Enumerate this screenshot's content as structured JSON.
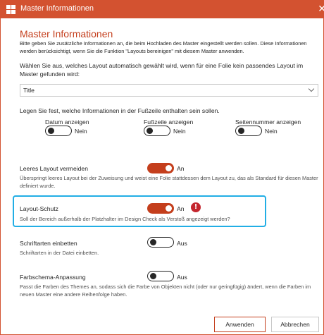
{
  "window": {
    "title": "Master Informationen",
    "close_icon": "✕"
  },
  "heading": "Master Informationen",
  "intro": "Bitte geben Sie zusätzliche Informationen an, die beim Hochladen des Master eingestellt werden sollen. Diese Informationen werden berücksichtigt, wenn Sie die Funktion \"Layouts bereinigen\" mit diesem Master anwenden.",
  "layout_select": {
    "label": "Wählen Sie aus, welches Layout automatisch gewählt wird, wenn für eine Folie kein passendes Layout im Master gefunden wird:",
    "value": "Title"
  },
  "footer": {
    "label": "Legen Sie fest, welche Informationen in der Fußzeile enthalten sein sollen.",
    "items": [
      {
        "label": "Datum anzeigen",
        "state": "Nein"
      },
      {
        "label": "Fußzeile anzeigen",
        "state": "Nein"
      },
      {
        "label": "Seitennummer anzeigen",
        "state": "Nein"
      }
    ]
  },
  "settings": {
    "empty_layout": {
      "label": "Leeres Layout vermeiden",
      "state": "An",
      "desc": "Überspringt leeres Layout bei der Zuweisung und weist eine Folie stattdessen dem Layout zu, das als Standard für diesen Master definiert wurde."
    },
    "layout_protection": {
      "label": "Layout-Schutz",
      "state": "An",
      "warning": "!",
      "desc": "Soll der Bereich außerhalb der Platzhalter im Design Check als Verstoß angezeigt werden?"
    },
    "embed_fonts": {
      "label": "Schriftarten einbetten",
      "state": "Aus",
      "desc": "Schriftarten in der Datei einbetten."
    },
    "color_scheme": {
      "label": "Farbschema-Anpassung",
      "state": "Aus",
      "desc": "Passt die Farben des Themes an, sodass sich die Farbe von Objekten nicht (oder nur geringfügig) ändert, wenn die Farben im neuen Master eine andere Reihenfolge haben."
    }
  },
  "buttons": {
    "apply": "Anwenden",
    "cancel": "Abbrechen"
  },
  "colors": {
    "accent": "#c43e1c",
    "titlebar": "#d35230",
    "highlight": "#22aee5",
    "warning": "#c4262e"
  }
}
